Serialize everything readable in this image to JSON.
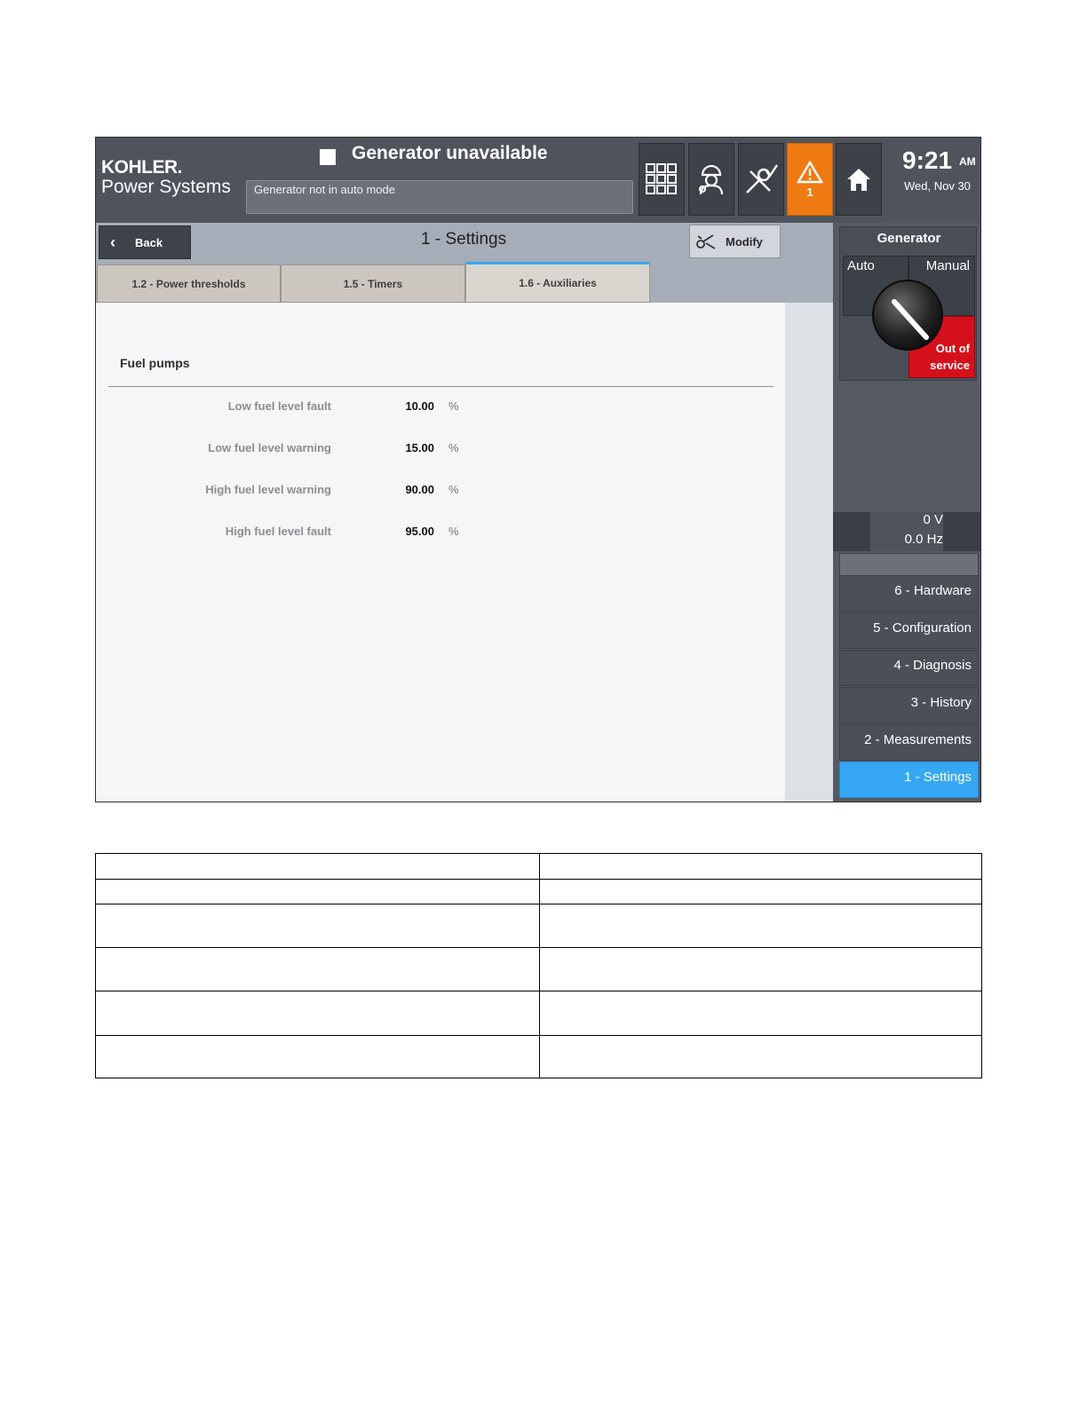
{
  "header": {
    "logo_line1": "KOHLER.",
    "logo_line2": "Power Systems",
    "status_title": "Generator unavailable",
    "status_message": "Generator not in auto mode",
    "alarm_count": "1",
    "time": "9:21",
    "ampm": "AM",
    "date": "Wed, Nov 30",
    "alarm_color": "#f07a12"
  },
  "titlebar": {
    "back_label": "Back",
    "title": "1 - Settings",
    "modify_label": "Modify"
  },
  "tabs": [
    {
      "label": "1.2 - Power thresholds",
      "active": false
    },
    {
      "label": "1.5 - Timers",
      "active": false
    },
    {
      "label": "1.6 - Auxiliaries",
      "active": true
    }
  ],
  "content": {
    "section_title": "Fuel pumps",
    "rows": [
      {
        "label": "Low fuel level fault",
        "value": "10.00",
        "unit": "%"
      },
      {
        "label": "Low fuel level warning",
        "value": "15.00",
        "unit": "%"
      },
      {
        "label": "High fuel level warning",
        "value": "90.00",
        "unit": "%"
      },
      {
        "label": "High fuel level fault",
        "value": "95.00",
        "unit": "%"
      }
    ]
  },
  "generator": {
    "title": "Generator",
    "mode_auto": "Auto",
    "mode_manual": "Manual",
    "mode_oos_line1": "Out of",
    "mode_oos_line2": "service",
    "voltage": "0 V",
    "frequency": "0.0 Hz",
    "oos_color": "#d4111b"
  },
  "menu": [
    {
      "label": "6 - Hardware",
      "active": false
    },
    {
      "label": "5 - Configuration",
      "active": false
    },
    {
      "label": "4 - Diagnosis",
      "active": false
    },
    {
      "label": "3 - History",
      "active": false
    },
    {
      "label": "2 - Measurements",
      "active": false
    },
    {
      "label": "1 - Settings",
      "active": true
    }
  ],
  "menu_active_color": "#36a7f4",
  "doc_table": {
    "rows": [
      [
        "",
        ""
      ],
      [
        "",
        ""
      ],
      [
        "",
        ""
      ],
      [
        "",
        ""
      ],
      [
        "",
        ""
      ],
      [
        "",
        ""
      ]
    ]
  }
}
